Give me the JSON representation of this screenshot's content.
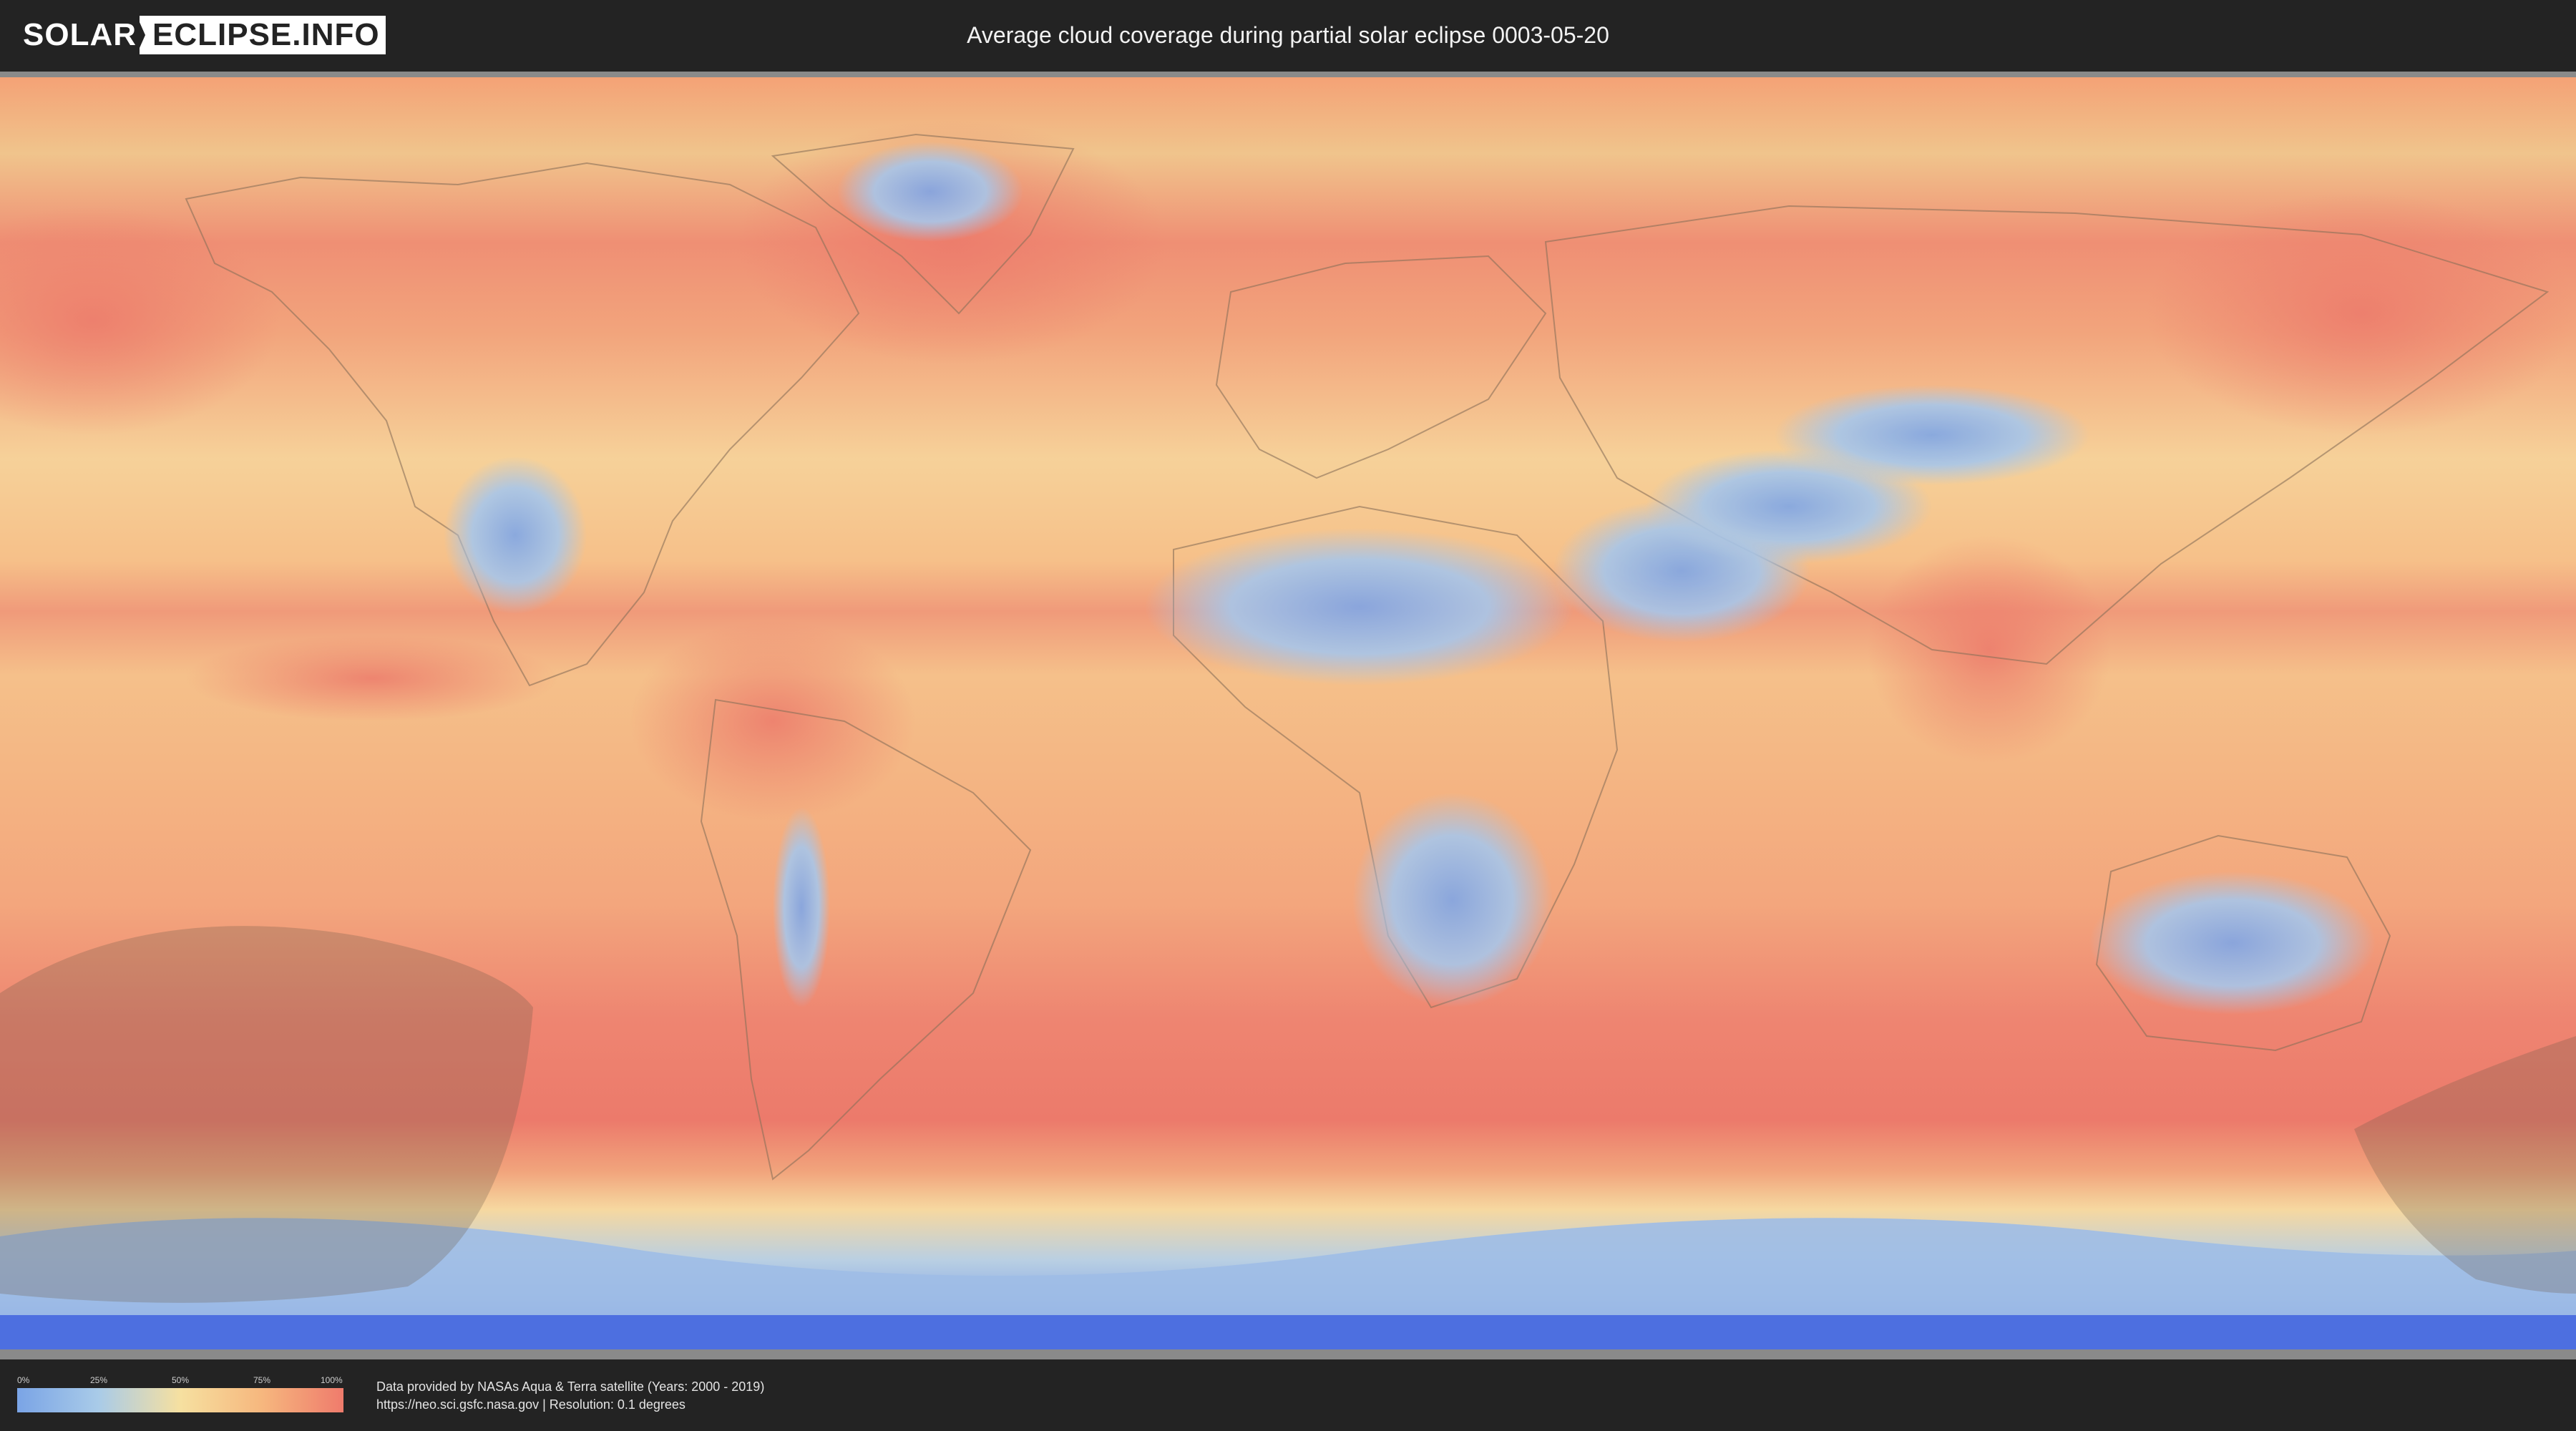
{
  "header": {
    "logo_left": "SOLAR",
    "logo_right": "ECLIPSE.INFO",
    "title": "Average cloud coverage during partial solar eclipse 0003-05-20"
  },
  "legend": {
    "ticks": [
      "0%",
      "25%",
      "50%",
      "75%",
      "100%"
    ],
    "tick_fractions": [
      0,
      0.25,
      0.5,
      0.75,
      1
    ],
    "colors": [
      "#7aa4e6",
      "#a9cbe8",
      "#f6e0a0",
      "#f6b77e",
      "#ef7b6c"
    ]
  },
  "footer": {
    "source_line": "Data provided by NASAs Aqua & Terra satellite (Years: 2000 - 2019)",
    "info_line": "https://neo.sci.gsfc.nasa.gov | Resolution: 0.1 degrees"
  },
  "map": {
    "projection": "equirectangular",
    "cloud_palette": {
      "clear": "#7aa4e6",
      "light": "#a9cbe8",
      "medium": "#f6e0a0",
      "heavy": "#f6b77e",
      "overcast": "#ef7b6c"
    },
    "eclipse_shadow_color": "#6b5a48",
    "antarctic_ice_color": "#4d6fe0"
  }
}
